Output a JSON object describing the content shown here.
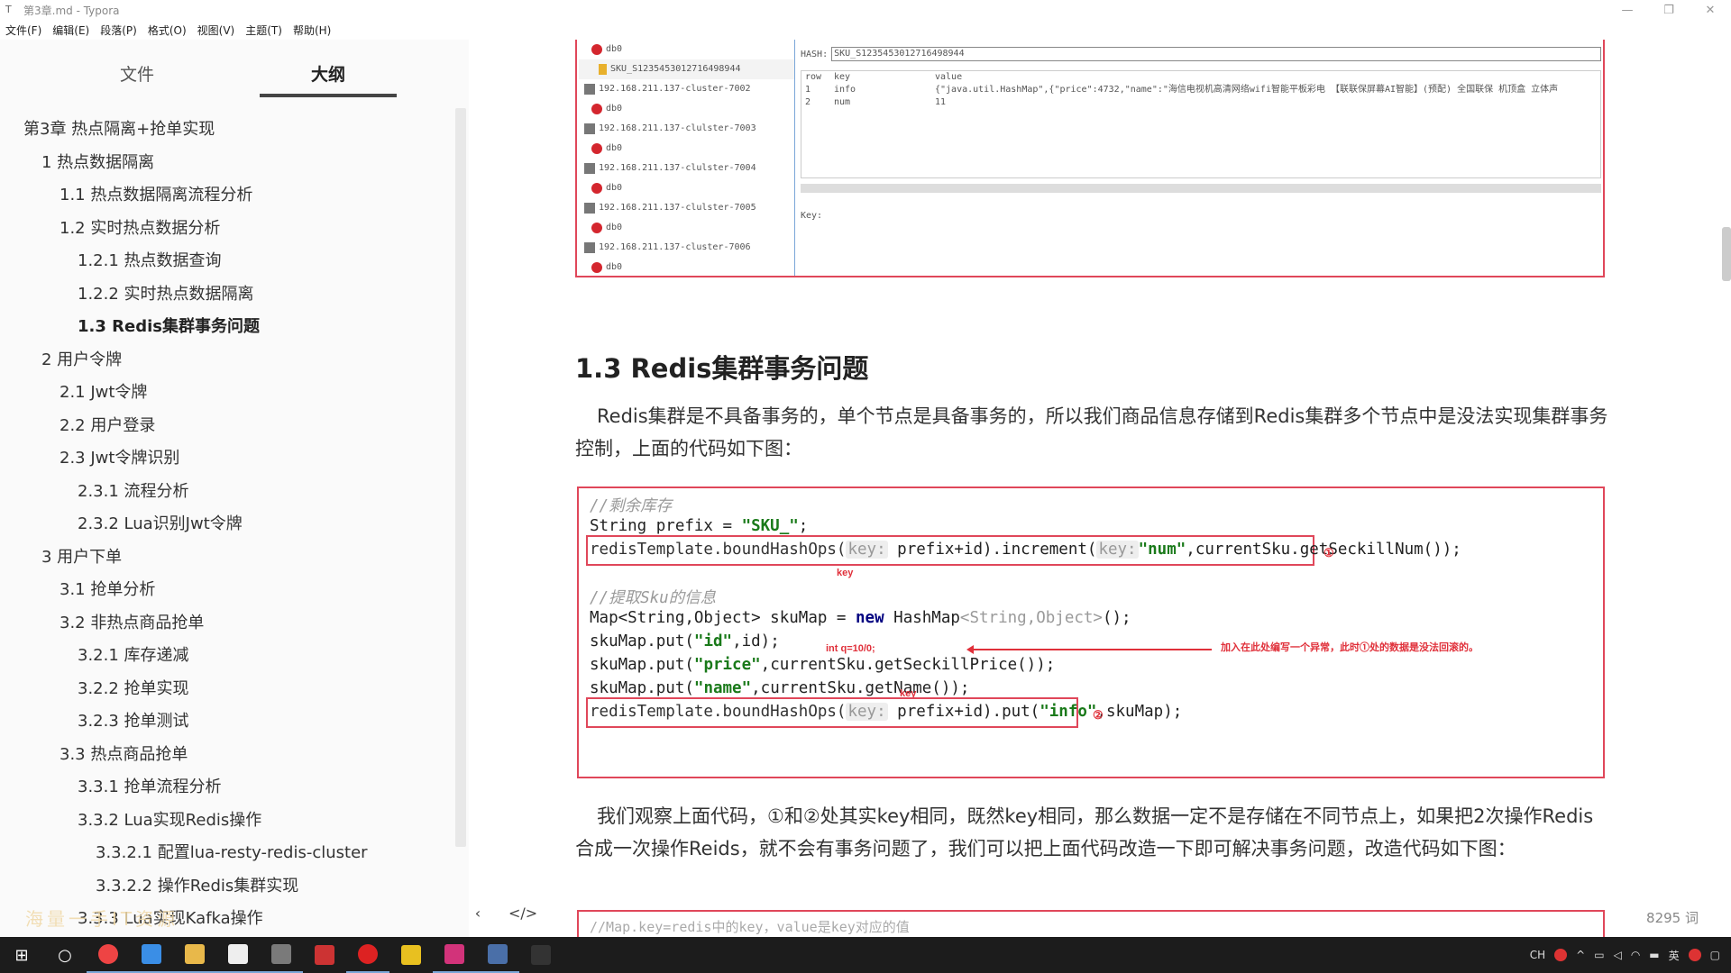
{
  "window": {
    "title": "第3章.md - Typora",
    "controls": [
      "—",
      "❐",
      "✕"
    ]
  },
  "menu": [
    "文件(F)",
    "编辑(E)",
    "段落(P)",
    "格式(O)",
    "视图(V)",
    "主题(T)",
    "帮助(H)"
  ],
  "sidebar": {
    "tab_files": "文件",
    "tab_outline": "大纲",
    "outline": [
      {
        "label": "第3章 热点隔离+抢单实现",
        "level": 1
      },
      {
        "label": "1 热点数据隔离",
        "level": 2
      },
      {
        "label": "1.1 热点数据隔离流程分析",
        "level": 3
      },
      {
        "label": "1.2 实时热点数据分析",
        "level": 3
      },
      {
        "label": "1.2.1 热点数据查询",
        "level": 4
      },
      {
        "label": "1.2.2 实时热点数据隔离",
        "level": 4
      },
      {
        "label": "1.3 Redis集群事务问题",
        "level": 4,
        "active": true
      },
      {
        "label": "2 用户令牌",
        "level": 2
      },
      {
        "label": "2.1 Jwt令牌",
        "level": 3
      },
      {
        "label": "2.2 用户登录",
        "level": 3
      },
      {
        "label": "2.3 Jwt令牌识别",
        "level": 3
      },
      {
        "label": "2.3.1 流程分析",
        "level": 4
      },
      {
        "label": "2.3.2 Lua识别Jwt令牌",
        "level": 4
      },
      {
        "label": "3 用户下单",
        "level": 2
      },
      {
        "label": "3.1 抢单分析",
        "level": 3
      },
      {
        "label": "3.2 非热点商品抢单",
        "level": 3
      },
      {
        "label": "3.2.1 库存递减",
        "level": 4
      },
      {
        "label": "3.2.2 抢单实现",
        "level": 4
      },
      {
        "label": "3.2.3 抢单测试",
        "level": 4
      },
      {
        "label": "3.3 热点商品抢单",
        "level": 3
      },
      {
        "label": "3.3.1 抢单流程分析",
        "level": 4
      },
      {
        "label": "3.3.2 Lua实现Redis操作",
        "level": 4
      },
      {
        "label": "3.3.2.1 配置lua-resty-redis-cluster",
        "level": 5
      },
      {
        "label": "3.3.2.2 操作Redis集群实现",
        "level": 5
      },
      {
        "label": "3.3.3 Lua实现Kafka操作",
        "level": 4
      }
    ],
    "bottom_left": "‹",
    "bottom_code": "</>"
  },
  "watermark": "海量一手IT资源",
  "word_count": "8295 词",
  "redis_shot": {
    "tree": [
      {
        "type": "db",
        "label": "db0"
      },
      {
        "type": "key",
        "label": "SKU_S1235453012716498944"
      },
      {
        "type": "server",
        "label": "192.168.211.137-cluster-7002"
      },
      {
        "type": "db",
        "label": "db0"
      },
      {
        "type": "server",
        "label": "192.168.211.137-clulster-7003"
      },
      {
        "type": "db",
        "label": "db0"
      },
      {
        "type": "server",
        "label": "192.168.211.137-clulster-7004"
      },
      {
        "type": "db",
        "label": "db0"
      },
      {
        "type": "server",
        "label": "192.168.211.137-clulster-7005"
      },
      {
        "type": "db",
        "label": "db0"
      },
      {
        "type": "server",
        "label": "192.168.211.137-cluster-7006"
      },
      {
        "type": "db",
        "label": "db0"
      }
    ],
    "hash_label": "HASH:",
    "hash_value": "SKU_S1235453012716498944",
    "table_header": [
      "row",
      "key",
      "value"
    ],
    "table_rows": [
      [
        "1",
        "info",
        "{\"java.util.HashMap\",{\"price\":4732,\"name\":\"海信电视机高清网络wifi智能平板彩电 【联联保屏幕AI智能】(预配) 全国联保  机顶盒  立体声"
      ],
      [
        "2",
        "num",
        "11"
      ]
    ],
    "key_label": "Key:"
  },
  "section_title": "1.3 Redis集群事务问题",
  "para1": "Redis集群是不具备事务的，单个节点是具备事务的，所以我们商品信息存储到Redis集群多个节点中是没法实现集群事务控制，上面的代码如下图：",
  "code1": {
    "c1": "//剩余库存",
    "l2a": "String prefix = ",
    "l2b": "\"SKU_\"",
    "l2c": ";",
    "l3a": "redisTemplate.boundHashOps(",
    "l3hint1": "key:",
    "l3b": " prefix+id).increment(",
    "l3hint2": "key:",
    "l3c": "\"num\"",
    "l3d": ",currentSku.getSeckillNum());",
    "c2": "//提取Sku的信息",
    "l5a": "Map<String,Object> skuMap = ",
    "l5kw": "new",
    "l5b": " HashMap",
    "l5c": "<String,Object>",
    "l5d": "();",
    "l6a": "skuMap.put(",
    "l6b": "\"id\"",
    "l6c": ",id);",
    "l7a": "skuMap.put(",
    "l7b": "\"price\"",
    "l7c": ",currentSku.getSeckillPrice());",
    "l8a": "skuMap.put(",
    "l8b": "\"name\"",
    "l8c": ",currentSku.getName());",
    "l9a": "redisTemplate.boundHashOps(",
    "l9hint": "key:",
    "l9b": " prefix+id).put(",
    "l9c": "\"info\"",
    "l9d": ",skuMap);",
    "anno_key1": "key",
    "anno_key2": "key",
    "anno_intq": "int q=10/0;",
    "anno_note": "加入在此处编写一个异常，此时①处的数据是没法回滚的。",
    "anno_c1": "①",
    "anno_c2": "②"
  },
  "para2": "我们观察上面代码，①和②处其实key相同，既然key相同，那么数据一定不是存储在不同节点上，如果把2次操作Redis合成一次操作Reids，就不会有事务问题了，我们可以把上面代码改造一下即可解决事务问题，改造代码如下图：",
  "code2_line": "//Map.key=redis中的key，value是key对应的值",
  "taskbar": {
    "tray_lang": "CH",
    "tray_ime": "英"
  }
}
